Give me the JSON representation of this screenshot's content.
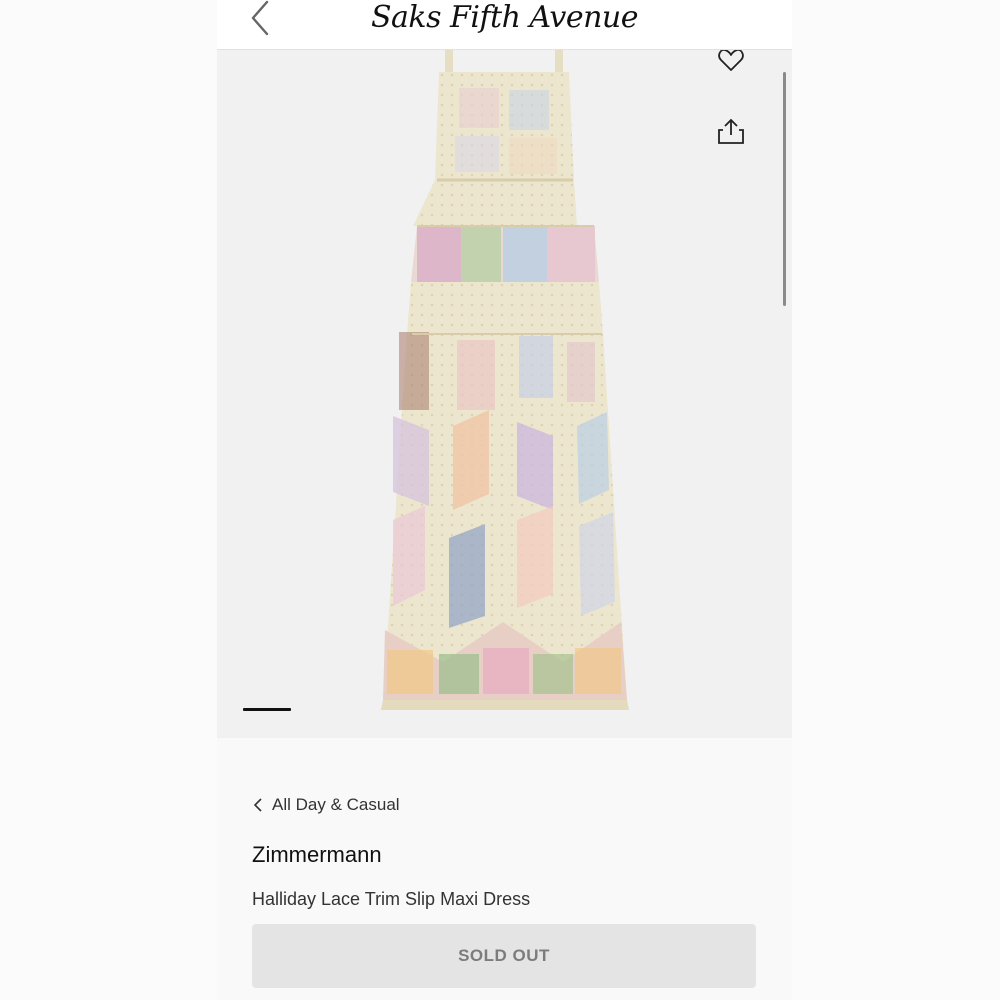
{
  "header": {
    "logo": "Saks Fifth Avenue",
    "back_icon": "chevron-left-icon"
  },
  "gallery": {
    "favorite_icon": "heart-icon",
    "share_icon": "share-icon",
    "product_image": "floral patchwork lace maxi dress"
  },
  "product": {
    "breadcrumb": "All Day & Casual",
    "brand": "Zimmermann",
    "name": "Halliday Lace Trim Slip Maxi Dress",
    "status_button": "SOLD OUT"
  },
  "colors": {
    "accent": "#111111",
    "sold_out_bg": "#e4e4e4",
    "sold_out_text": "#7c7c7c",
    "dress_base": "#ede6cf"
  }
}
